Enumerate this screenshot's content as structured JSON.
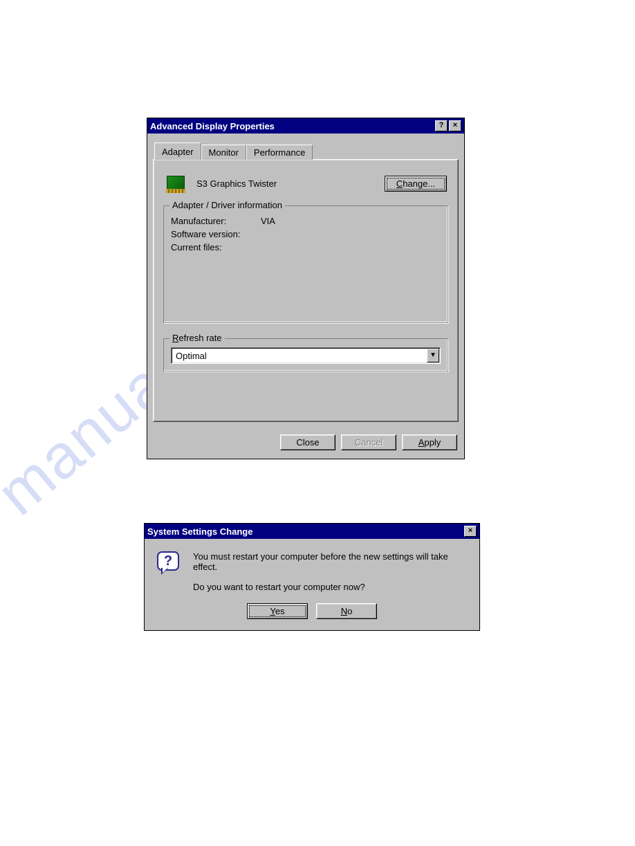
{
  "window1": {
    "title": "Advanced Display Properties",
    "tabs": [
      "Adapter",
      "Monitor",
      "Performance"
    ],
    "adapter_name": "S3 Graphics Twister",
    "change_btn": "Change...",
    "group_driver": {
      "legend": "Adapter / Driver information",
      "manufacturer_label": "Manufacturer:",
      "manufacturer_value": "VIA",
      "swver_label": "Software version:",
      "swver_value": "",
      "files_label": "Current files:",
      "files_value": ""
    },
    "group_refresh": {
      "legend": "Refresh rate",
      "value": "Optimal"
    },
    "actions": {
      "close": "Close",
      "cancel": "Cancel",
      "apply": "Apply"
    }
  },
  "window2": {
    "title": "System Settings Change",
    "line1": "You must restart your computer before the new settings will take effect.",
    "line2": "Do you want to restart your computer now?",
    "yes": "Yes",
    "no": "No"
  }
}
